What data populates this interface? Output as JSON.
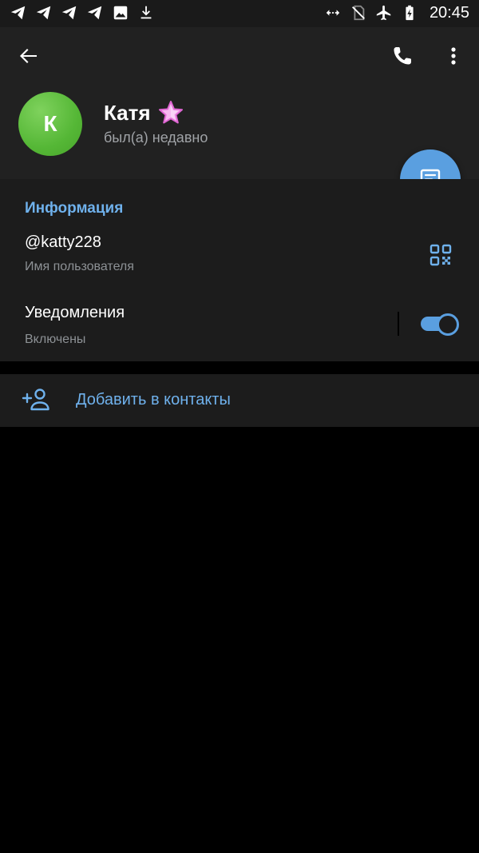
{
  "status_bar": {
    "time": "20:45",
    "left_icons": [
      "telegram-icon",
      "telegram-icon",
      "telegram-icon",
      "telegram-icon",
      "image-icon",
      "download-icon"
    ],
    "right_icons": [
      "data-saver-icon",
      "no-sim-icon",
      "airplane-icon",
      "battery-charging-icon"
    ]
  },
  "header": {
    "avatar_initial": "К",
    "name": "Катя",
    "status": "был(а) недавно"
  },
  "info": {
    "section_title": "Информация",
    "username": "@katty228",
    "username_caption": "Имя пользователя",
    "notifications_label": "Уведомления",
    "notifications_value": "Включены",
    "notifications_on": true
  },
  "actions": {
    "add_contact": "Добавить в контакты"
  },
  "colors": {
    "accent": "#5a9fe0",
    "link_text": "#6fb1ec",
    "avatar": "#55b736",
    "header_bg": "#212121",
    "section_bg": "#1c1c1c"
  }
}
